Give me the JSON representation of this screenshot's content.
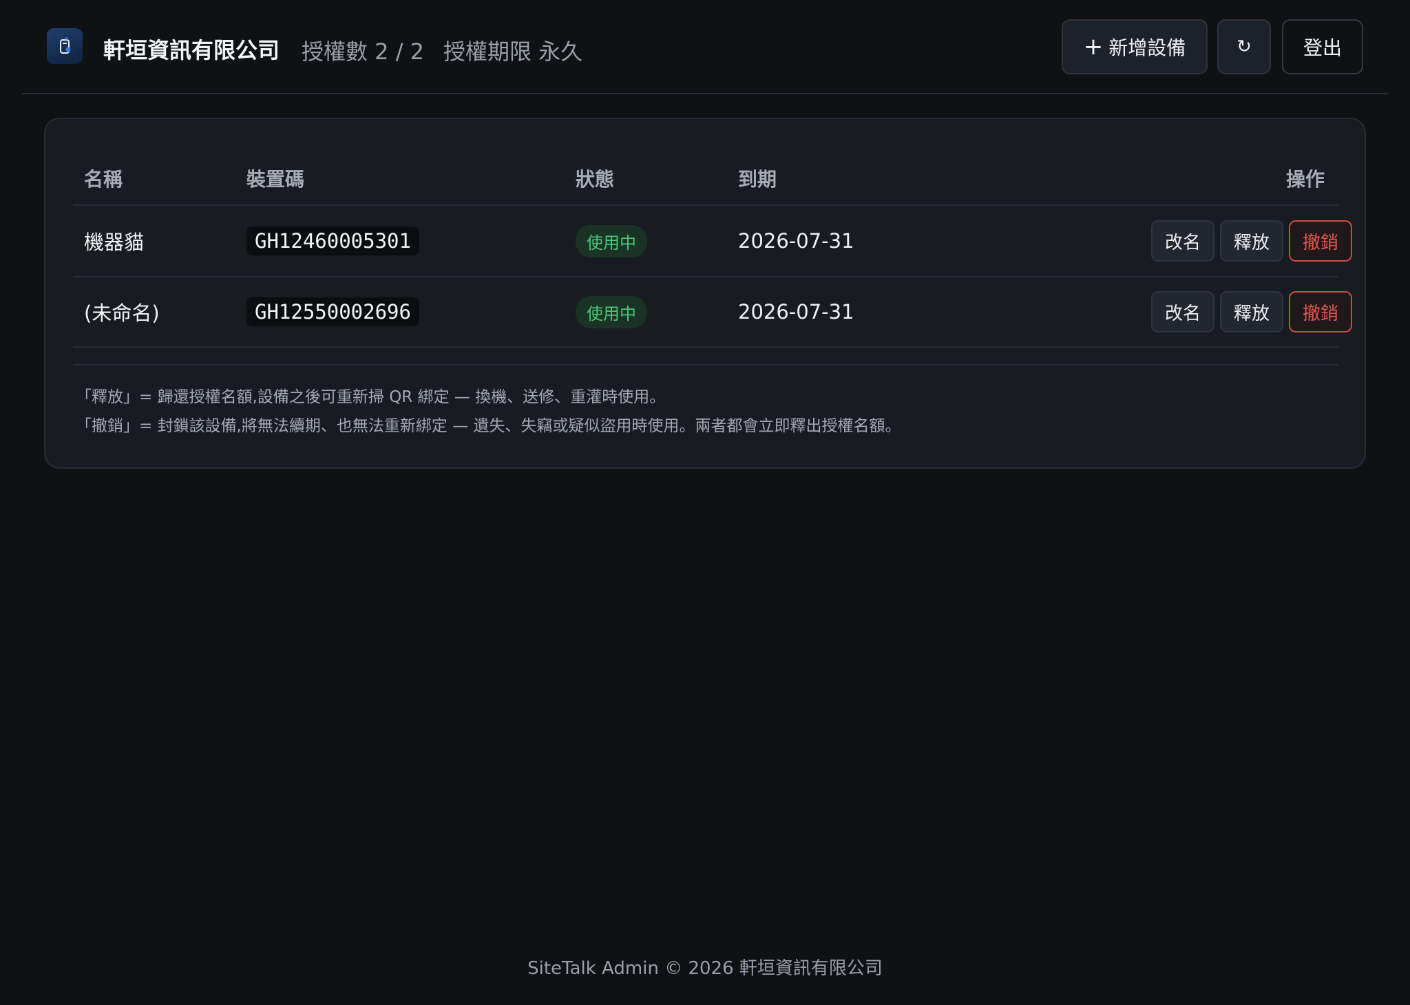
{
  "header": {
    "company": "軒垣資訊有限公司",
    "license_count": "授權數 2 / 2",
    "license_term": "授權期限 永久",
    "add_button": "新增設備",
    "add_icon": "plus-icon",
    "refresh_icon": "↻",
    "logout_button": "登出",
    "logo_icon": "phone-app-icon"
  },
  "table": {
    "headers": {
      "name": "名稱",
      "code": "裝置碼",
      "status": "狀態",
      "expiry": "到期",
      "actions": "操作"
    },
    "rows": [
      {
        "name": "機器貓",
        "code": "GH12460005301",
        "status": "使用中",
        "expiry": "2026-07-31",
        "rename": "改名",
        "release": "釋放",
        "revoke": "撤銷"
      },
      {
        "name": "(未命名)",
        "code": "GH12550002696",
        "status": "使用中",
        "expiry": "2026-07-31",
        "rename": "改名",
        "release": "釋放",
        "revoke": "撤銷"
      }
    ]
  },
  "notes": {
    "release": "「釋放」= 歸還授權名額,設備之後可重新掃 QR 綁定 — 換機、送修、重灌時使用。",
    "revoke": "「撤銷」= 封鎖該設備,將無法續期、也無法重新綁定 — 遺失、失竊或疑似盜用時使用。兩者都會立即釋出授權名額。"
  },
  "footer": "SiteTalk Admin © 2026 軒垣資訊有限公司",
  "colors": {
    "background": "#0f1115",
    "card": "#181b21",
    "status_green": "#4cc777",
    "danger_red": "#e2574f"
  }
}
